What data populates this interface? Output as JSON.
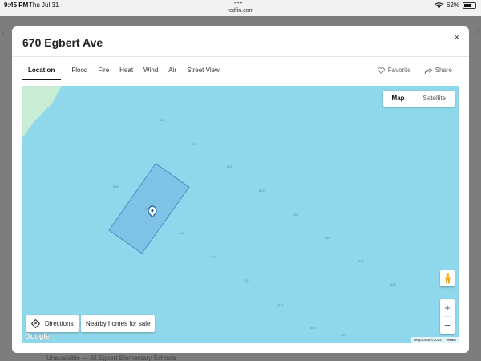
{
  "status_bar": {
    "time": "9:45 PM",
    "date": "Thu Jul 31",
    "url": "redfin.com",
    "more_dots": "•••",
    "battery": "62%",
    "wifi_icon": "wifi-icon",
    "battery_icon": "battery-icon"
  },
  "modal": {
    "title": "670 Egbert Ave",
    "close": "×",
    "tabs": [
      {
        "label": "Location",
        "active": true
      },
      {
        "label": "Flood"
      },
      {
        "label": "Fire"
      },
      {
        "label": "Heat"
      },
      {
        "label": "Wind"
      },
      {
        "label": "Air"
      },
      {
        "label": "Street View"
      }
    ],
    "favorite": "Favorite",
    "share": "Share"
  },
  "map": {
    "map_type": {
      "map": "Map",
      "satellite": "Satellite",
      "selected": "Map"
    },
    "lot_numbers": [
      "681",
      "672",
      "661",
      "680",
      "674",
      "651",
      "660",
      "641",
      "656",
      "631",
      "646",
      "621",
      "636",
      "611",
      "626",
      "601"
    ],
    "directions_label": "Directions",
    "nearby_label": "Nearby homes for sale",
    "zoom_in": "+",
    "zoom_out": "−",
    "google_logo": "Google",
    "map_data": "Map Data ©2025",
    "terms": "Terms",
    "colors": {
      "water": "#8fd7ea",
      "land": "#c8ecd4",
      "parcel": "#7ec3e6",
      "parcel_border": "#3f7fc4",
      "pin": "#1a5e9a"
    }
  },
  "background": {
    "footer_text": "Unavailable — All Egbert Elementary Schools"
  }
}
